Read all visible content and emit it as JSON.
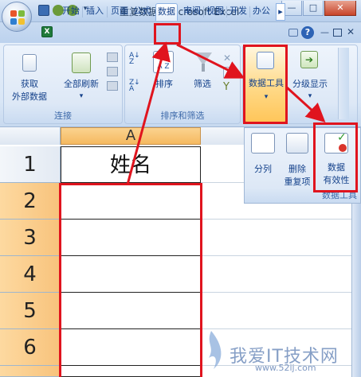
{
  "window": {
    "title": "重复数据 - Microsoft Excel",
    "minimize": "—",
    "maximize": "□",
    "close": "✕"
  },
  "tabs": [
    {
      "label": "开始"
    },
    {
      "label": "插入"
    },
    {
      "label": "页面"
    },
    {
      "label": "公式"
    },
    {
      "label": "数据"
    },
    {
      "label": "审阅"
    },
    {
      "label": "视图"
    },
    {
      "label": "开发"
    },
    {
      "label": "办公"
    }
  ],
  "ribbon_extra": {
    "more": "▸",
    "help": "?"
  },
  "groups": {
    "connections": {
      "label": "连接",
      "get_external_line1": "获取",
      "get_external_line2": "外部数据",
      "refresh_all": "全部刷新"
    },
    "sort_filter": {
      "label": "排序和筛选",
      "sort": "排序",
      "filter": "筛选"
    },
    "data_tools": {
      "button": "数据工具",
      "outline": "分级显示"
    }
  },
  "popup": {
    "group_label": "数据工具",
    "text_to_columns": "分列",
    "remove_dup_line1": "删除",
    "remove_dup_line2": "重复项",
    "validation_line1": "数据",
    "validation_line2": "有效性"
  },
  "sheet": {
    "column_header": "A",
    "rows": [
      {
        "num": "1",
        "value": "姓名"
      },
      {
        "num": "2",
        "value": ""
      },
      {
        "num": "3",
        "value": ""
      },
      {
        "num": "4",
        "value": ""
      },
      {
        "num": "5",
        "value": ""
      },
      {
        "num": "6",
        "value": ""
      }
    ]
  },
  "watermark": {
    "text": "我爱IT技术网",
    "url": "www.52ij.com"
  },
  "colors": {
    "highlight": "#e0141e",
    "selected_header": "#f8c37c",
    "ribbon": "#dde8f6"
  }
}
